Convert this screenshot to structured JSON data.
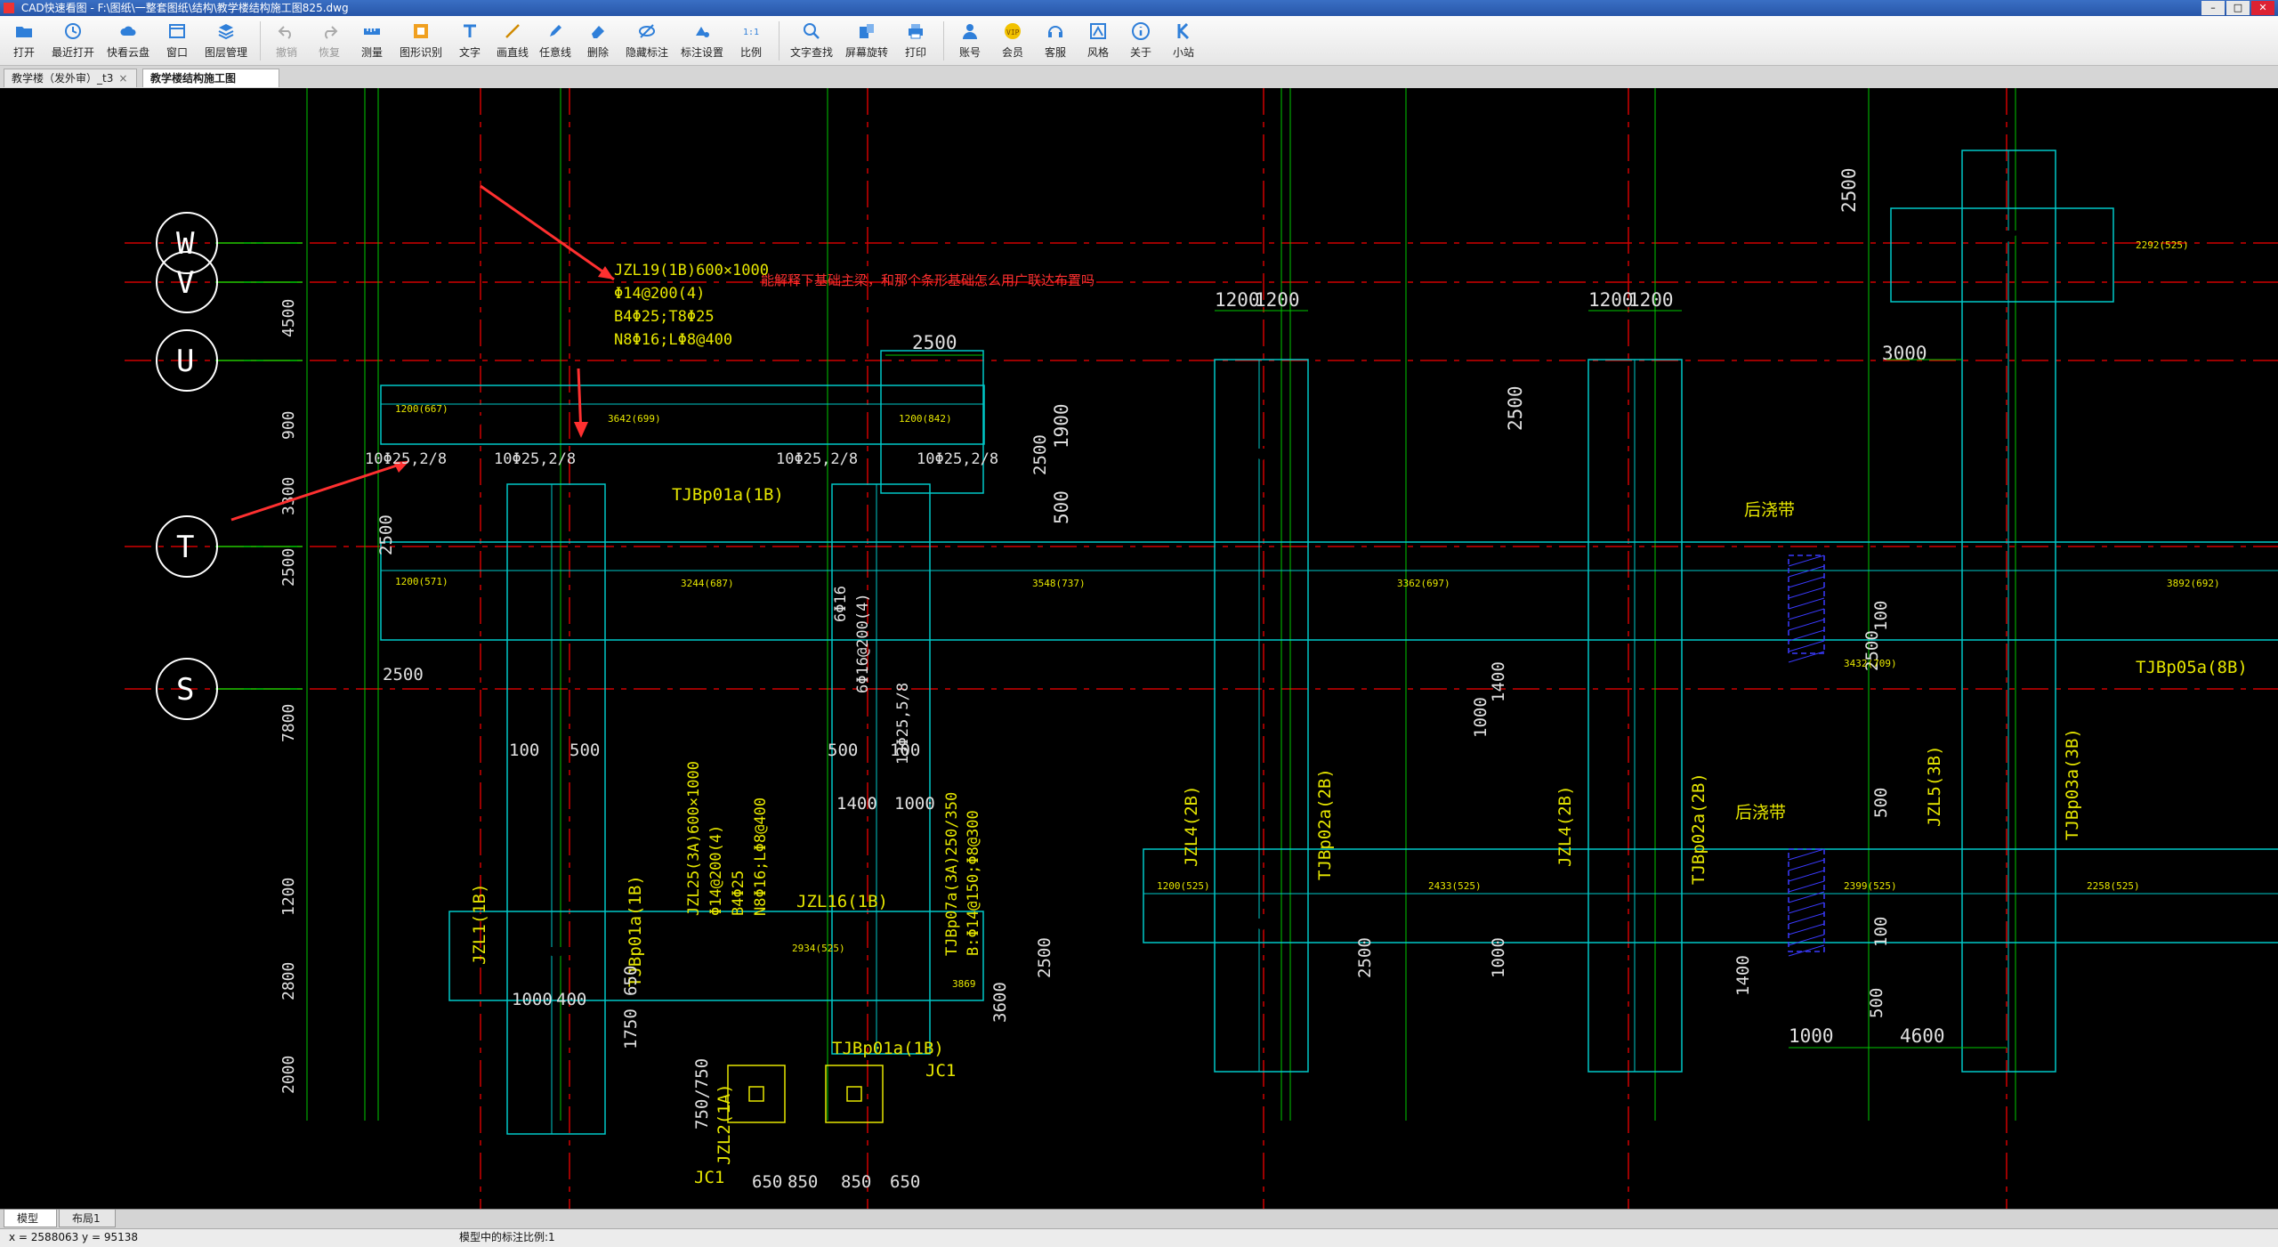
{
  "window": {
    "title": "CAD快速看图 - F:\\图纸\\一整套图纸\\结构\\教学楼结构施工图825.dwg"
  },
  "toolbar": [
    {
      "id": "open",
      "label": "打开",
      "icon": "folder-open-icon",
      "enabled": true
    },
    {
      "id": "recent",
      "label": "最近打开",
      "icon": "clock-icon",
      "enabled": true
    },
    {
      "id": "cloud",
      "label": "快看云盘",
      "icon": "cloud-icon",
      "enabled": true
    },
    {
      "id": "window",
      "label": "窗口",
      "icon": "window-icon",
      "enabled": true
    },
    {
      "id": "layers",
      "label": "图层管理",
      "icon": "layers-icon",
      "enabled": true
    },
    {
      "id": "undo",
      "label": "撤销",
      "icon": "undo-icon",
      "enabled": false
    },
    {
      "id": "redo",
      "label": "恢复",
      "icon": "redo-icon",
      "enabled": false
    },
    {
      "id": "measure",
      "label": "测量",
      "icon": "ruler-icon",
      "enabled": true
    },
    {
      "id": "recognize",
      "label": "图形识别",
      "icon": "shape-recognize-icon",
      "enabled": true
    },
    {
      "id": "text",
      "label": "文字",
      "icon": "text-icon",
      "enabled": true
    },
    {
      "id": "line",
      "label": "画直线",
      "icon": "line-icon",
      "enabled": true
    },
    {
      "id": "freeline",
      "label": "任意线",
      "icon": "pen-icon",
      "enabled": true
    },
    {
      "id": "delete",
      "label": "删除",
      "icon": "eraser-icon",
      "enabled": true
    },
    {
      "id": "hidemark",
      "label": "隐藏标注",
      "icon": "eye-hidden-icon",
      "enabled": true
    },
    {
      "id": "marksettings",
      "label": "标注设置",
      "icon": "mark-settings-icon",
      "enabled": true
    },
    {
      "id": "scale",
      "label": "比例",
      "icon": "scale-icon",
      "enabled": true
    },
    {
      "id": "textsearch",
      "label": "文字查找",
      "icon": "search-icon",
      "enabled": true
    },
    {
      "id": "rotate",
      "label": "屏幕旋转",
      "icon": "rotate-icon",
      "enabled": true
    },
    {
      "id": "print",
      "label": "打印",
      "icon": "printer-icon",
      "enabled": true
    },
    {
      "id": "account",
      "label": "账号",
      "icon": "user-icon",
      "enabled": true
    },
    {
      "id": "vip",
      "label": "会员",
      "icon": "vip-icon",
      "enabled": true
    },
    {
      "id": "service",
      "label": "客服",
      "icon": "headset-icon",
      "enabled": true
    },
    {
      "id": "style",
      "label": "风格",
      "icon": "style-icon",
      "enabled": true
    },
    {
      "id": "about",
      "label": "关于",
      "icon": "info-icon",
      "enabled": true
    },
    {
      "id": "mini",
      "label": "小站",
      "icon": "k-logo-icon",
      "enabled": true
    }
  ],
  "tabs": [
    {
      "label": "教学楼（发外审）_t3",
      "active": false
    },
    {
      "label": "教学楼结构施工图825",
      "active": true
    }
  ],
  "layout_tabs": [
    {
      "label": "模型",
      "active": true
    },
    {
      "label": "布局1",
      "active": false
    }
  ],
  "status": {
    "coords": "x = 2588063  y = 95138",
    "scale_text": "模型中的标注比例:1"
  },
  "colors": {
    "axis_green": "#00c800",
    "axis_red": "#d00000",
    "beam_cyan": "#00c8c8",
    "text_yellow": "#e6e600",
    "dim_white": "#e0e0e0",
    "note_red": "#ff3030",
    "blue_hatch": "#3a3aff",
    "bubble": "#ffffff"
  },
  "drawing": {
    "axis_bubbles": [
      "W",
      "V",
      "U",
      "T",
      "S"
    ],
    "left_dims": [
      "4500",
      "900",
      "3300",
      "2500",
      "7800",
      "1200",
      "2800",
      "2000"
    ],
    "annotation_note": "能解释下基础主梁，和那个条形基础怎么用广联达布置吗",
    "beam_spec_1": [
      "JZL19(1B)600×1000",
      "Φ14@200(4)",
      "B4Φ25;T8Φ25",
      "N8Φ16;LΦ8@400"
    ],
    "beam_spec_2": [
      "JZL25(3A)600×1000",
      "Φ14@200(4)",
      "B4Φ25",
      "N8Φ16;LΦ8@400"
    ],
    "beam_spec_3": [
      "TJBp07a(3A)250/350",
      "B:Φ14@150;Φ8@300"
    ],
    "rebar_labels": [
      "10Φ25,2/8",
      "10Φ25,2/8",
      "10Φ25,2/8",
      "10Φ25,2/8",
      "13Φ25,5/8",
      "6Φ16",
      "6Φ16@200(4)"
    ],
    "tag_labels": [
      {
        "text": "TJBp01a(1B)",
        "pos": "mid-upper"
      },
      {
        "text": "TJBp01a(1B)",
        "pos": "left-mid"
      },
      {
        "text": "TJBp01a(1B)",
        "pos": "bottom-center"
      },
      {
        "text": "JZL1(1B)",
        "pos": "left"
      },
      {
        "text": "JZL16(1B)",
        "pos": "bottom"
      },
      {
        "text": "JZL2(1A)",
        "pos": "bottom-left"
      },
      {
        "text": "JZL4(2B)",
        "pos": "mid-right-1"
      },
      {
        "text": "TJBp02a(2B)",
        "pos": "mid-right-1b"
      },
      {
        "text": "JZL4(2B)",
        "pos": "mid-right-2"
      },
      {
        "text": "TJBp02a(2B)",
        "pos": "mid-right-2b"
      },
      {
        "text": "JZL5(3B)",
        "pos": "right"
      },
      {
        "text": "TJBp03a(3B)",
        "pos": "right-b"
      },
      {
        "text": "TJBp05a(8B)",
        "pos": "far-right"
      },
      {
        "text": "后浇带",
        "pos": "upper"
      },
      {
        "text": "后浇带",
        "pos": "lower"
      },
      {
        "text": "JC1",
        "pos": "c1"
      },
      {
        "text": "JC1",
        "pos": "c2"
      }
    ],
    "top_dims": [
      "2500",
      "1200",
      "1200",
      "1200",
      "1200",
      "2500",
      "3000",
      "2500",
      "1900",
      "500",
      "4600",
      "1000"
    ],
    "misc_dims": [
      "100",
      "500",
      "500",
      "100",
      "1400",
      "1000",
      "3600",
      "1750",
      "650",
      "1000",
      "400",
      "750/750",
      "650",
      "850",
      "850",
      "650",
      "2500",
      "2500",
      "1000",
      "1400",
      "2500",
      "1000",
      "1400",
      "2500",
      "100",
      "500",
      "100",
      "500",
      "2500",
      "2500"
    ]
  }
}
